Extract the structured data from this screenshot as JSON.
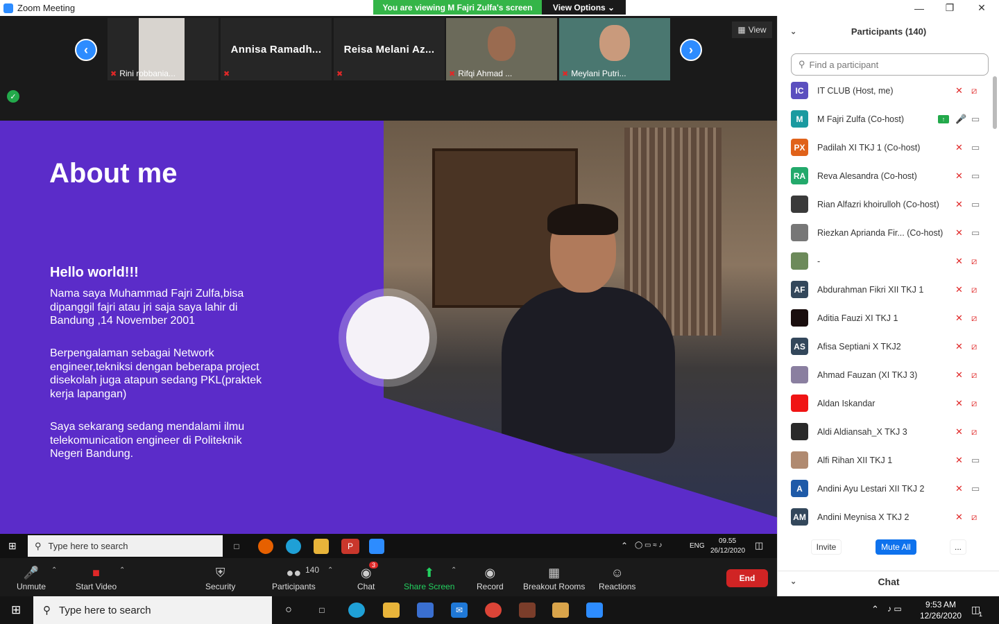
{
  "window": {
    "title": "Zoom Meeting",
    "banner": "You are viewing M Fajri Zulfa's screen",
    "view_options": "View Options ⌄"
  },
  "gallery": {
    "tiles": [
      {
        "name": "Rini robbania...",
        "big": ""
      },
      {
        "name": "",
        "big": "Annisa  Ramadh..."
      },
      {
        "name": "",
        "big": "Reisa  Melani  Az..."
      },
      {
        "name": "Rifqi Ahmad ...",
        "big": ""
      },
      {
        "name": "Meylani Putri...",
        "big": ""
      }
    ],
    "view_label": "View"
  },
  "slide": {
    "title": "About me",
    "heading": "Hello world!!!",
    "p1": "Nama saya Muhammad Fajri Zulfa,bisa dipanggil fajri atau jri saja saya lahir di Bandung ,14 November 2001",
    "p2": "Berpengalaman sebagai Network engineer,tekniksi dengan beberapa project disekolah juga atapun sedang PKL(praktek kerja lapangan)",
    "p3": "Saya sekarang sedang mendalami ilmu telekomunication engineer di Politeknik Negeri Bandung."
  },
  "inner_taskbar": {
    "search": "Type here to search",
    "time": "09.55",
    "date": "26/12/2020",
    "lang": "ENG"
  },
  "toolbar": {
    "unmute": "Unmute",
    "start_video": "Start Video",
    "security": "Security",
    "participants": "Participants",
    "participants_count": "140",
    "chat": "Chat",
    "chat_badge": "3",
    "share": "Share Screen",
    "record": "Record",
    "breakout": "Breakout Rooms",
    "reactions": "Reactions",
    "end": "End"
  },
  "os_taskbar": {
    "search": "Type here to search",
    "time": "9:53 AM",
    "date": "12/26/2020",
    "notif_count": "1"
  },
  "panel": {
    "title": "Participants (140)",
    "search_placeholder": "Find a participant",
    "participants": [
      {
        "initials": "IC",
        "color": "#5b4fbf",
        "name": "IT CLUB (Host, me)",
        "mic": "off",
        "cam": "off"
      },
      {
        "initials": "M",
        "color": "#1a9aa0",
        "name": "M Fajri Zulfa (Co-host)",
        "mic": "on",
        "cam": "on",
        "sharing": true
      },
      {
        "initials": "PX",
        "color": "#e0621a",
        "name": "Padilah XI TKJ 1 (Co-host)",
        "mic": "off",
        "cam": "on"
      },
      {
        "initials": "RA",
        "color": "#23a96b",
        "name": "Reva Alesandra (Co-host)",
        "mic": "off",
        "cam": "on"
      },
      {
        "initials": "",
        "color": "#3a3a3a",
        "name": "Rian Alfazri khoirulloh (Co-host)",
        "mic": "off",
        "cam": "on"
      },
      {
        "initials": "",
        "color": "#777777",
        "name": "Riezkan Aprianda Fir...    (Co-host)",
        "mic": "off",
        "cam": "on"
      },
      {
        "initials": "",
        "color": "#6c8a5a",
        "name": "-",
        "mic": "off",
        "cam": "off"
      },
      {
        "initials": "AF",
        "color": "#33475b",
        "name": "Abdurahman Fikri XII TKJ 1",
        "mic": "off",
        "cam": "off"
      },
      {
        "initials": "",
        "color": "#1a0e0e",
        "name": "Aditia Fauzi XI TKJ 1",
        "mic": "off",
        "cam": "off"
      },
      {
        "initials": "AS",
        "color": "#33475b",
        "name": "Afisa Septiani X TKJ2",
        "mic": "off",
        "cam": "off"
      },
      {
        "initials": "",
        "color": "#8a7fa0",
        "name": "Ahmad Fauzan (XI TKJ 3)",
        "mic": "off",
        "cam": "off"
      },
      {
        "initials": "",
        "color": "#f01414",
        "name": "Aldan Iskandar",
        "mic": "off",
        "cam": "off"
      },
      {
        "initials": "",
        "color": "#2a2a2a",
        "name": "Aldi Aldiansah_X TKJ 3",
        "mic": "off",
        "cam": "off"
      },
      {
        "initials": "",
        "color": "#b08a70",
        "name": "Alfi Rihan XII TKJ 1",
        "mic": "off",
        "cam": "on"
      },
      {
        "initials": "A",
        "color": "#1e5aa8",
        "name": "Andini Ayu Lestari XII TKJ 2",
        "mic": "off",
        "cam": "on"
      },
      {
        "initials": "AM",
        "color": "#33475b",
        "name": "Andini Meynisa X TKJ 2",
        "mic": "off",
        "cam": "off"
      }
    ],
    "invite": "Invite",
    "mute_all": "Mute All",
    "more": "...",
    "chat_title": "Chat"
  }
}
